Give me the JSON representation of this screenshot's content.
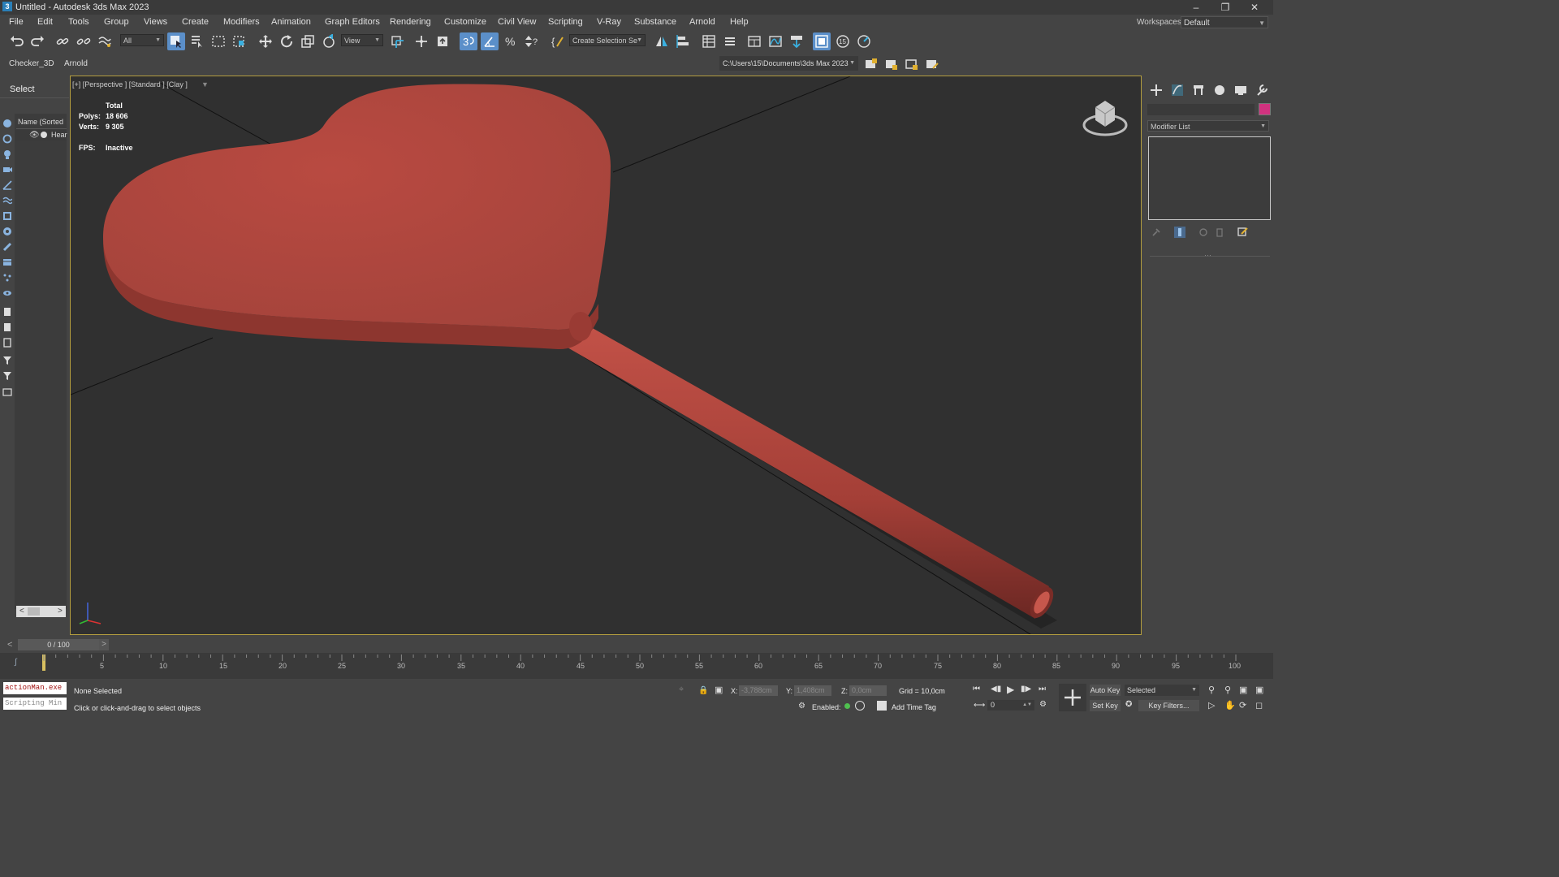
{
  "window": {
    "title": "Untitled - Autodesk 3ds Max 2023",
    "app_icon": "3"
  },
  "menu": [
    "File",
    "Edit",
    "Tools",
    "Group",
    "Views",
    "Create",
    "Modifiers",
    "Animation",
    "Graph Editors",
    "Rendering",
    "Customize",
    "Civil View",
    "Scripting",
    "V-Ray",
    "Substance",
    "Arnold",
    "Help"
  ],
  "workspace": {
    "label": "Workspaces:",
    "value": "Default"
  },
  "toolbar": {
    "filter_value": "All",
    "ref_coord_value": "View",
    "named_sel_value": "Create Selection Se"
  },
  "toolbar2": {
    "tabs": [
      "Checker_3D",
      "Arnold"
    ],
    "project_path": "C:\\Users\\15\\Documents\\3ds Max 2023"
  },
  "scene_explorer": {
    "select_label": "Select",
    "column_header": "Name (Sorted A",
    "item_label": "Hear"
  },
  "viewport": {
    "label": "[+] [Perspective ] [Standard ] [Clay ]",
    "stats": {
      "total_label": "Total",
      "polys_label": "Polys:",
      "polys_value": "18 606",
      "verts_label": "Verts:",
      "verts_value": "9 305",
      "fps_label": "FPS:",
      "fps_value": "Inactive"
    }
  },
  "command_panel": {
    "modifier_list": "Modifier List",
    "color_swatch": "#d0327f"
  },
  "timeline": {
    "slider_value": "0 / 100",
    "ticks": [
      "5",
      "10",
      "15",
      "20",
      "25",
      "30",
      "35",
      "40",
      "45",
      "50",
      "55",
      "60",
      "65",
      "70",
      "75",
      "80",
      "85",
      "90",
      "95",
      "100"
    ]
  },
  "status": {
    "selection": "None Selected",
    "prompt": "Click or click-and-drag to select objects",
    "x_label": "X:",
    "x_value": "-3,788cm",
    "y_label": "Y:",
    "y_value": "1,408cm",
    "z_label": "Z:",
    "z_value": "0,0cm",
    "grid": "Grid = 10,0cm",
    "enabled_label": "Enabled:",
    "add_time_tag": "Add Time Tag",
    "auto_key": "Auto Key",
    "set_key": "Set Key",
    "key_mode_value": "Selected",
    "key_filters": "Key Filters...",
    "frame_value": "0"
  },
  "maxscript": {
    "line1": "actionMan.exe",
    "line2": "Scripting Min"
  },
  "colors": {
    "viewport_bg": "#303030",
    "viewport_border": "#b39d3f",
    "object": "#b2473f",
    "active_button": "#5b8fc9"
  }
}
